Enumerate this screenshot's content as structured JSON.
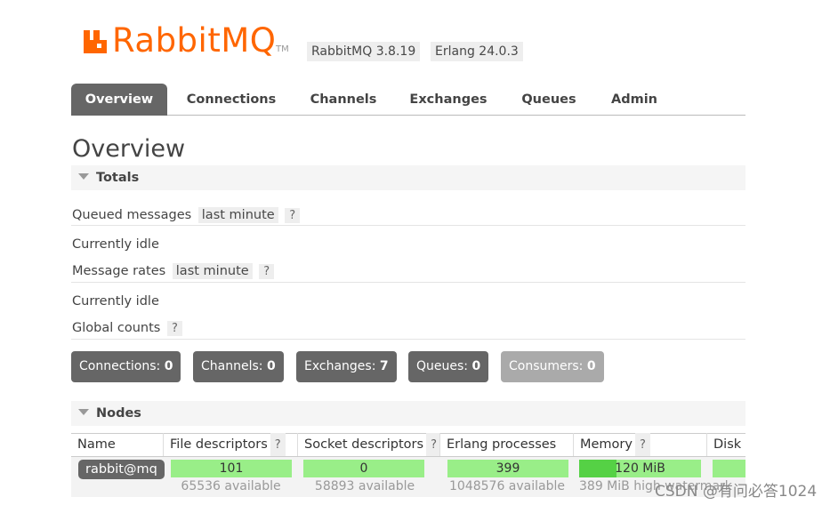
{
  "header": {
    "logo_text": "RabbitMQ",
    "logo_tm": "TM",
    "rabbitmq_version": "RabbitMQ 3.8.19",
    "erlang_version": "Erlang 24.0.3",
    "brand_color": "#ff6600"
  },
  "tabs": [
    {
      "label": "Overview",
      "active": true
    },
    {
      "label": "Connections",
      "active": false
    },
    {
      "label": "Channels",
      "active": false
    },
    {
      "label": "Exchanges",
      "active": false
    },
    {
      "label": "Queues",
      "active": false
    },
    {
      "label": "Admin",
      "active": false
    }
  ],
  "page_title": "Overview",
  "totals": {
    "header": "Totals",
    "queued_label": "Queued messages",
    "queued_range": "last minute",
    "help": "?",
    "queued_status": "Currently idle",
    "rates_label": "Message rates",
    "rates_range": "last minute",
    "rates_status": "Currently idle",
    "global_counts_label": "Global counts"
  },
  "counts": [
    {
      "label": "Connections:",
      "value": "0"
    },
    {
      "label": "Channels:",
      "value": "0"
    },
    {
      "label": "Exchanges:",
      "value": "7"
    },
    {
      "label": "Queues:",
      "value": "0"
    },
    {
      "label": "Consumers:",
      "value": "0"
    }
  ],
  "nodes": {
    "header": "Nodes",
    "columns": [
      "Name",
      "File descriptors",
      "Socket descriptors",
      "Erlang processes",
      "Memory",
      "Disk space"
    ],
    "row": {
      "name": "rabbit@mq",
      "file_descriptors": "101",
      "file_descriptors_available": "65536 available",
      "socket_descriptors": "0",
      "socket_descriptors_available": "58893 available",
      "erlang_processes": "399",
      "erlang_processes_available": "1048576 available",
      "memory": "120 MiB",
      "memory_fraction": 0.31,
      "memory_high_watermark": "389 MiB high watermark"
    }
  },
  "watermark": "CSDN @有问必答1024"
}
